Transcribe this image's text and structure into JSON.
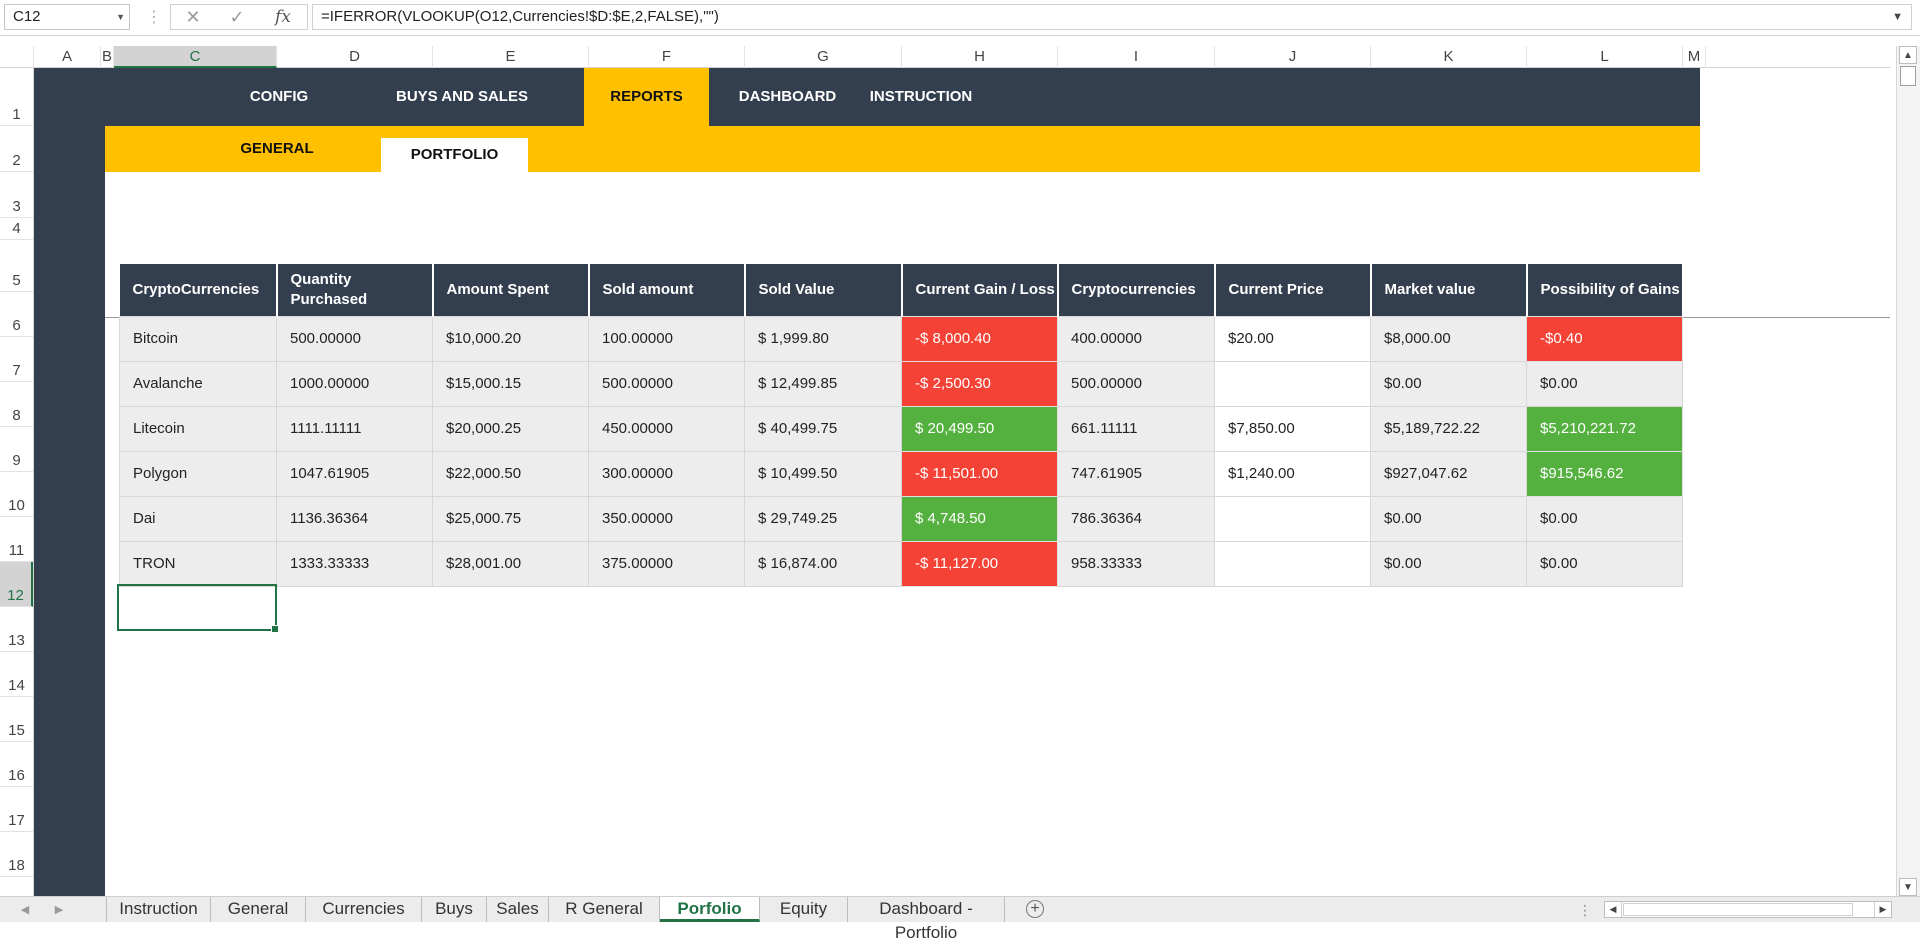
{
  "formula_bar": {
    "name_box": "C12",
    "formula": "=IFERROR(VLOOKUP(O12,Currencies!$D:$E,2,FALSE),\"\")",
    "fx_label": "fx"
  },
  "columns": [
    "A",
    "B",
    "C",
    "D",
    "E",
    "F",
    "G",
    "H",
    "I",
    "J",
    "K",
    "L",
    "M"
  ],
  "selected_column": "C",
  "rows": [
    "1",
    "2",
    "3",
    "4",
    "5",
    "6",
    "7",
    "8",
    "9",
    "10",
    "11",
    "12",
    "13",
    "14",
    "15",
    "16",
    "17",
    "18"
  ],
  "selected_row": "12",
  "nav": {
    "items": [
      "CONFIG",
      "BUYS AND SALES",
      "REPORTS",
      "DASHBOARD",
      "INSTRUCTION"
    ],
    "active": "REPORTS"
  },
  "subnav": {
    "items": [
      "GENERAL",
      "PORTFOLIO"
    ],
    "active": "PORTFOLIO"
  },
  "table": {
    "headers": [
      "CryptoCurrencies",
      "Quantity Purchased",
      "Amount Spent",
      "Sold amount",
      "Sold Value",
      "Current Gain / Loss",
      "Cryptocurrencies",
      "Current Price",
      "Market value",
      "Possibility of Gains"
    ],
    "rows": [
      {
        "name": "Bitcoin",
        "qty": "500.00000",
        "spent": "$10,000.20",
        "sold_amount": "100.00000",
        "sold_value": "$ 1,999.80",
        "gain": "-$ 8,000.40",
        "gain_status": "neg",
        "crypto": "400.00000",
        "price": "$20.00",
        "market": "$8,000.00",
        "possibility": "-$0.40",
        "possibility_status": "neg"
      },
      {
        "name": "Avalanche",
        "qty": "1000.00000",
        "spent": "$15,000.15",
        "sold_amount": "500.00000",
        "sold_value": "$ 12,499.85",
        "gain": "-$ 2,500.30",
        "gain_status": "neg",
        "crypto": "500.00000",
        "price": "",
        "market": "$0.00",
        "possibility": "$0.00",
        "possibility_status": "none"
      },
      {
        "name": "Litecoin",
        "qty": "1111.11111",
        "spent": "$20,000.25",
        "sold_amount": "450.00000",
        "sold_value": "$ 40,499.75",
        "gain": "$ 20,499.50",
        "gain_status": "pos",
        "crypto": "661.11111",
        "price": "$7,850.00",
        "market": "$5,189,722.22",
        "possibility": "$5,210,221.72",
        "possibility_status": "pos"
      },
      {
        "name": "Polygon",
        "qty": "1047.61905",
        "spent": "$22,000.50",
        "sold_amount": "300.00000",
        "sold_value": "$ 10,499.50",
        "gain": "-$ 11,501.00",
        "gain_status": "neg",
        "crypto": "747.61905",
        "price": "$1,240.00",
        "market": "$927,047.62",
        "possibility": "$915,546.62",
        "possibility_status": "pos"
      },
      {
        "name": "Dai",
        "qty": "1136.36364",
        "spent": "$25,000.75",
        "sold_amount": "350.00000",
        "sold_value": "$ 29,749.25",
        "gain": "$ 4,748.50",
        "gain_status": "pos",
        "crypto": "786.36364",
        "price": "",
        "market": "$0.00",
        "possibility": "$0.00",
        "possibility_status": "none"
      },
      {
        "name": "TRON",
        "qty": "1333.33333",
        "spent": "$28,001.00",
        "sold_amount": "375.00000",
        "sold_value": "$ 16,874.00",
        "gain": "-$ 11,127.00",
        "gain_status": "neg",
        "crypto": "958.33333",
        "price": "",
        "market": "$0.00",
        "possibility": "$0.00",
        "possibility_status": "none"
      }
    ]
  },
  "colors": {
    "dark": "#333f4f",
    "accent": "#ffc000",
    "negative": "#f44336",
    "positive": "#55b13f",
    "excel_green": "#217346"
  },
  "sheet_tabs": {
    "items": [
      "Instruction",
      "General",
      "Currencies",
      "Buys",
      "Sales",
      "R General",
      "Porfolio",
      "Equity",
      "Dashboard - Portfolio"
    ],
    "active": "Porfolio"
  }
}
